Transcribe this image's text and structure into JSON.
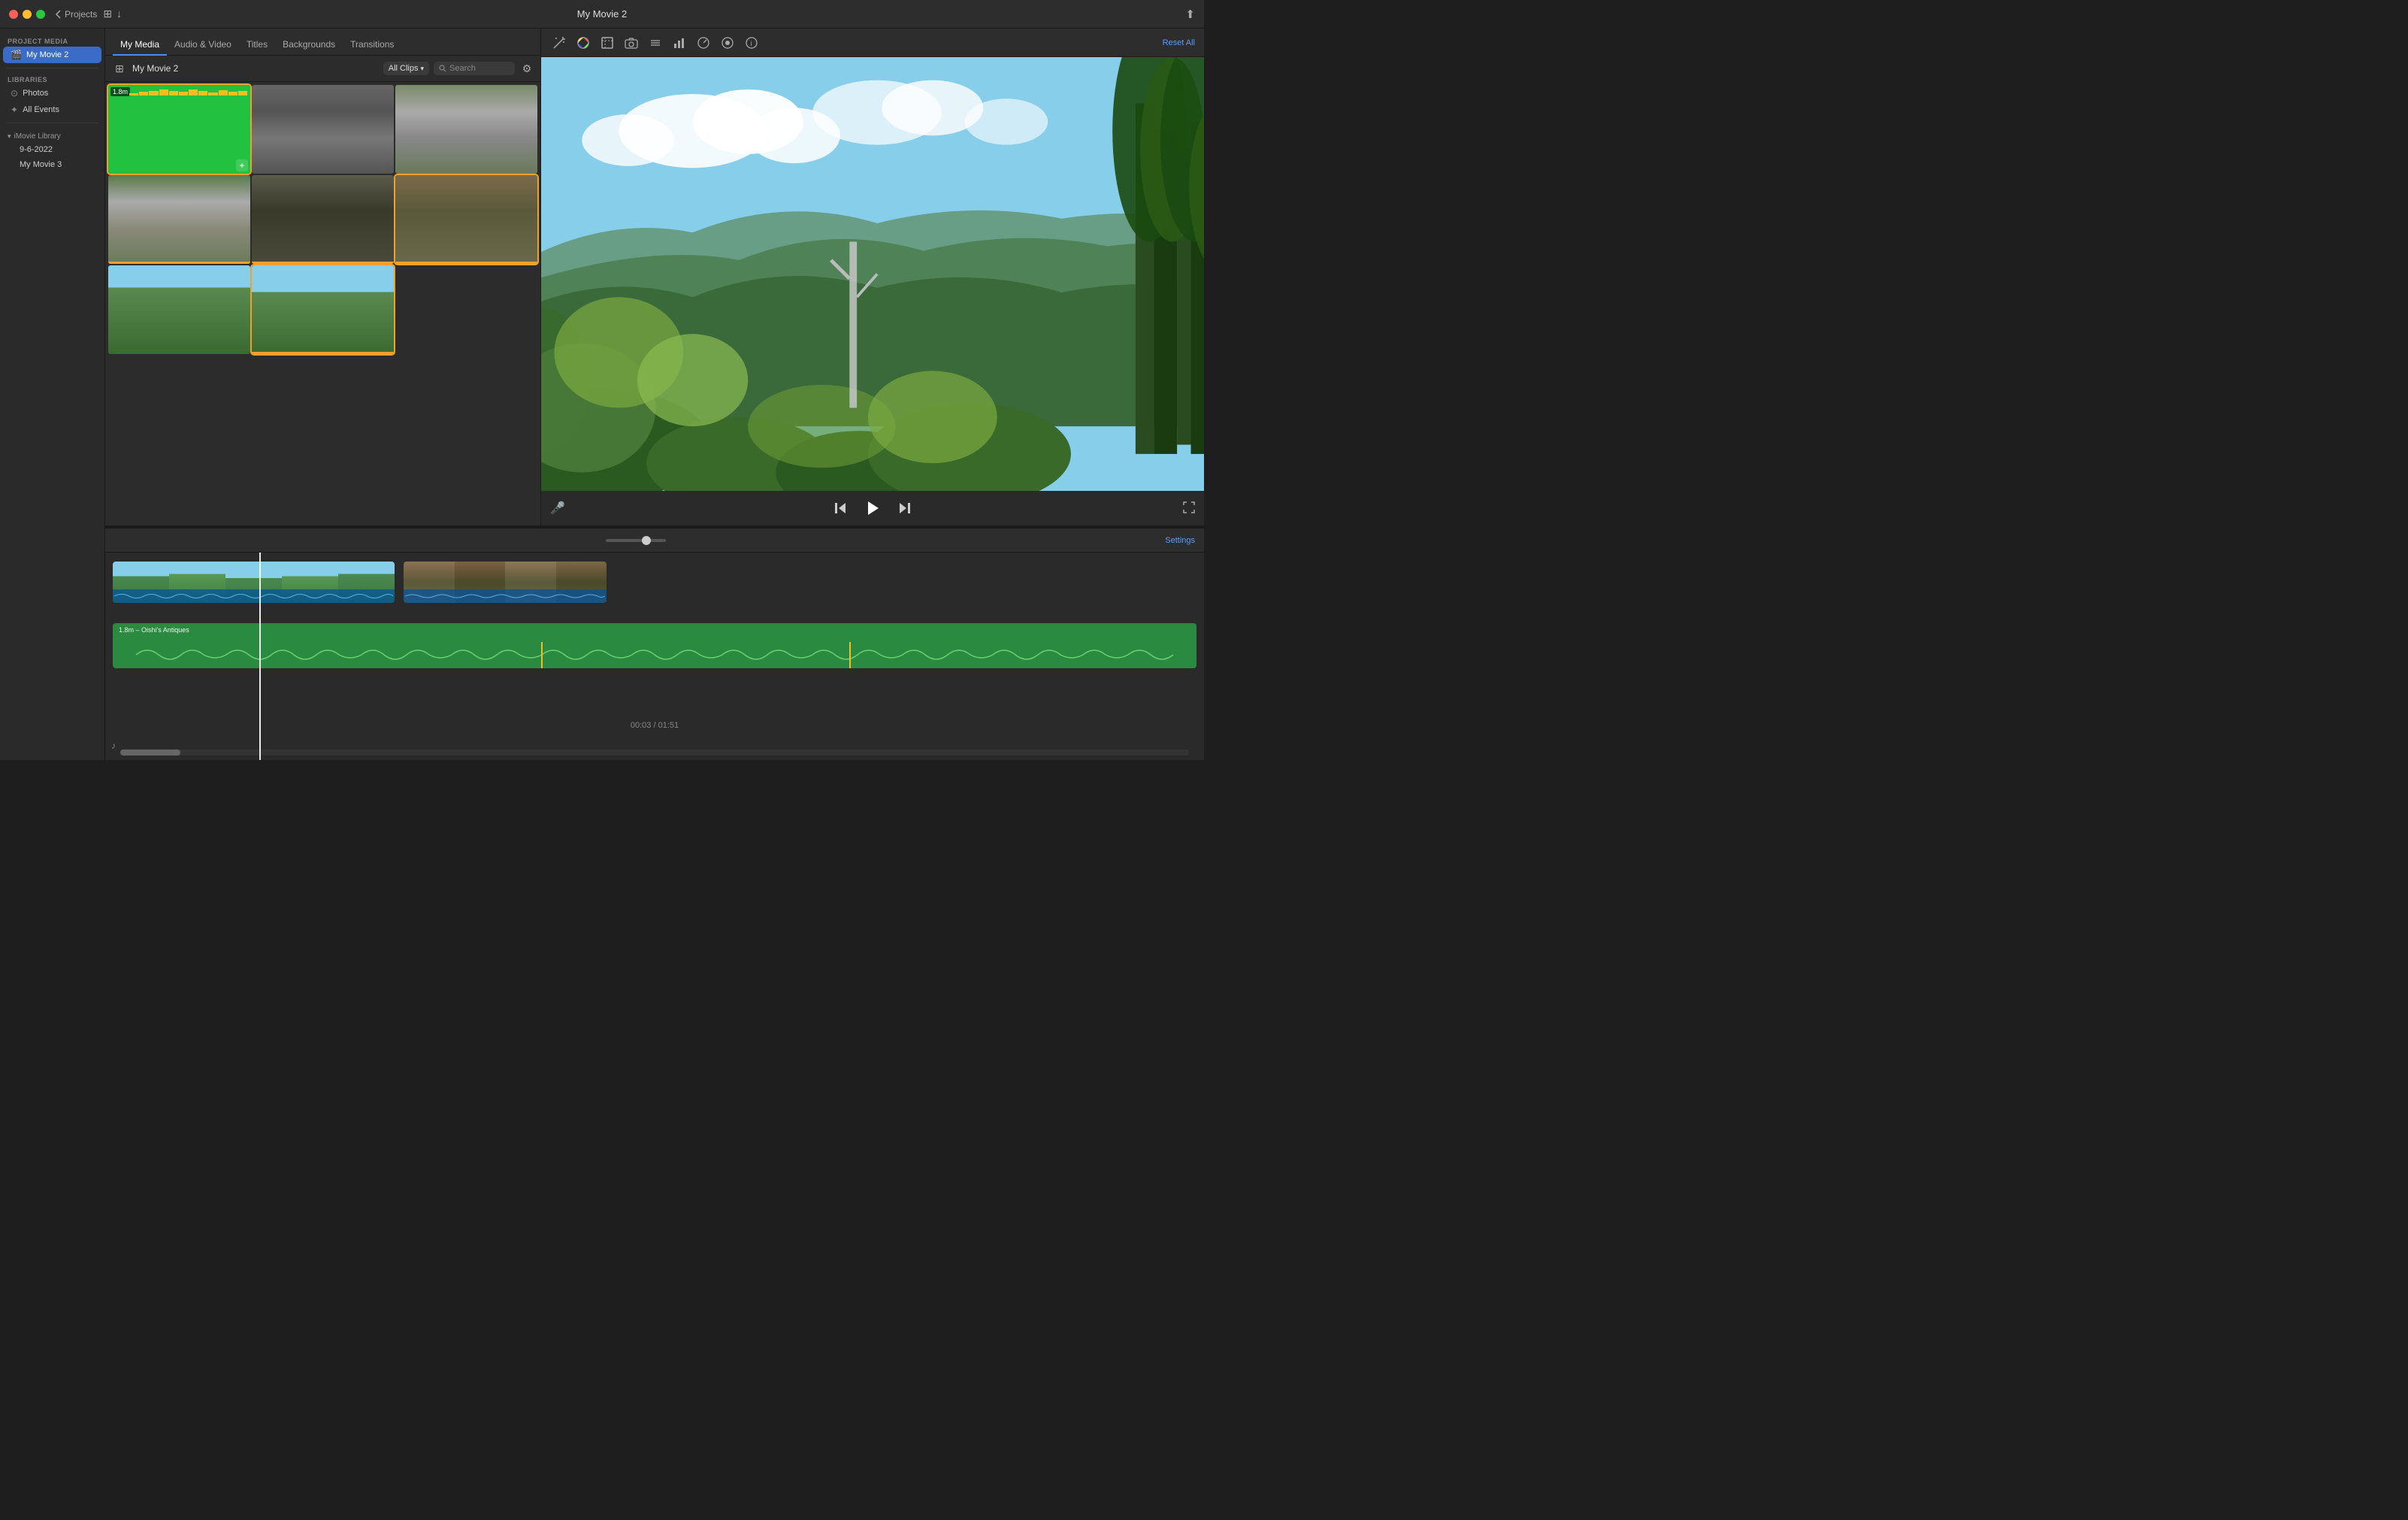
{
  "titleBar": {
    "title": "My Movie 2",
    "backLabel": "Projects"
  },
  "navTabs": {
    "items": [
      "My Media",
      "Audio & Video",
      "Titles",
      "Backgrounds",
      "Transitions"
    ],
    "active": "My Media"
  },
  "mediaToolbar": {
    "title": "My Movie 2",
    "clipsLabel": "All Clips",
    "searchPlaceholder": "Search"
  },
  "clips": [
    {
      "id": "clip1",
      "duration": "1.8m",
      "selected": true,
      "type": "green",
      "hasAdd": true
    },
    {
      "id": "clip2",
      "duration": "",
      "selected": false,
      "type": "rocks"
    },
    {
      "id": "clip3",
      "duration": "",
      "selected": false,
      "type": "waterfall"
    },
    {
      "id": "clip4",
      "duration": "",
      "selected": false,
      "type": "forest-stream"
    },
    {
      "id": "clip5",
      "duration": "",
      "selected": false,
      "type": "forest-trees"
    },
    {
      "id": "clip6",
      "duration": "",
      "selected": true,
      "type": "forest-path"
    },
    {
      "id": "clip7",
      "duration": "",
      "selected": false,
      "type": "green-bush"
    },
    {
      "id": "clip8",
      "duration": "",
      "selected": true,
      "type": "mountain-view"
    }
  ],
  "previewTools": {
    "resetAll": "Reset All"
  },
  "timeline": {
    "currentTime": "00:03",
    "totalTime": "01:51",
    "settingsLabel": "Settings",
    "musicTrackLabel": "1.8m – Oishi's Antiques"
  },
  "sidebar": {
    "projectMediaLabel": "PROJECT MEDIA",
    "projectName": "My Movie 2",
    "librariesLabel": "LIBRARIES",
    "photos": "Photos",
    "allEvents": "All Events",
    "imovieLibrary": "iMovie Library",
    "date1": "9-6-2022",
    "movie3": "My Movie 3"
  }
}
